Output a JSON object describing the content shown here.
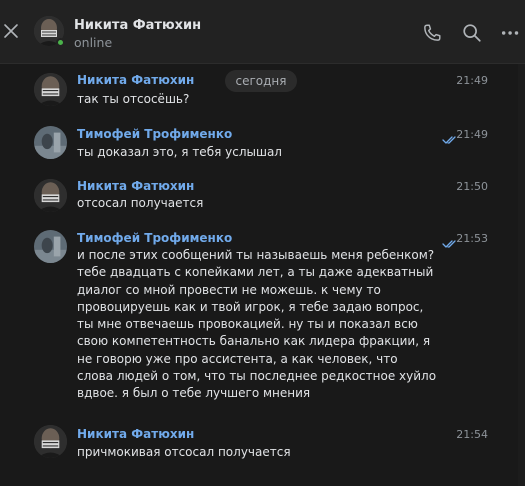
{
  "header": {
    "name": "Никита Фатюхин",
    "status": "online"
  },
  "date_separator": "сегодня",
  "messages": [
    {
      "author": "Никита Фатюхин",
      "time": "21:49",
      "text": "так ты отсосёшь?",
      "read": false
    },
    {
      "author": "Тимофей Трофименко",
      "time": "21:49",
      "text": "ты доказал это, я тебя услышал",
      "read": true
    },
    {
      "author": "Никита Фатюхин",
      "time": "21:50",
      "text": "отсосал получается",
      "read": false
    },
    {
      "author": "Тимофей Трофименко",
      "time": "21:53",
      "text": "и после этих сообщений ты называешь меня ребенком? тебе двадцать с копейками лет, а ты даже адекватный диалог со мной провести не можешь. к чему то провоцируешь как и твой игрок, я тебе задаю вопрос, ты мне отвечаешь провокацией. ну ты и показал всю свою компетентность банально как лидера фракции, я не говорю уже про ассистента, а как человек, что слова людей о том, что ты последнее редкостное хуйло вдвое. я был о тебе лучшего мнения",
      "read": true
    },
    {
      "author": "Никита Фатюхин",
      "time": "21:54",
      "text": "причмокивая отсосал получается",
      "read": false
    }
  ],
  "colors": {
    "background": "#191919",
    "header": "#222222",
    "author": "#71aaeb",
    "online": "#4bb34b",
    "read_check": "#71aaeb"
  }
}
